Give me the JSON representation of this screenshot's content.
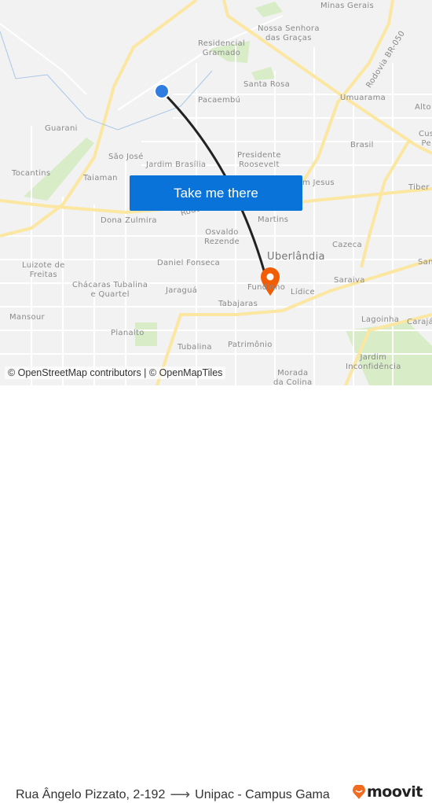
{
  "map": {
    "labels": [
      "Minas Gerais",
      "Nossa Senhora\ndas Graças",
      "Residencial\nGramado",
      "Santa Rosa",
      "Rodovia BR-050",
      "Umuarama",
      "Alto",
      "Pacaembú",
      "Guarani",
      "Brasil",
      "Cus\nPe",
      "São José",
      "Jardim Brasília",
      "Presidente\nRoosevelt",
      "Tocantins",
      "Taiaman",
      "m Jesus",
      "Tiber",
      "Rodo",
      "Dona Zulmira",
      "Martins",
      "Osvaldo\nRezende",
      "Luizote de\nFreitas",
      "Daniel Fonseca",
      "Cazeca",
      "San",
      "Chácaras Tubalina\ne Quartel",
      "Jaraguá",
      "Fundinho",
      "Lídice",
      "Saraiva",
      "Mansour",
      "Tabajaras",
      "Lagoinha",
      "Carajá",
      "Planalto",
      "Tubalina",
      "Patrimônio",
      "Jardim\nInconfidência",
      "Morada\nda Colina",
      "Uberlândia"
    ],
    "origin_color": "#2f7de1",
    "destination_color": "#f25c05",
    "route_color": "#222222"
  },
  "cta": {
    "label": "Take me there",
    "color": "#0a73d9"
  },
  "attribution": "© OpenStreetMap contributors | © OpenMapTiles",
  "footer": {
    "origin": "Rua Ângelo Pizzato, 2-192",
    "arrow_icon": "arrow-right-icon",
    "destination": "Unipac - Campus Gama",
    "brand": "moovit",
    "brand_color": "#f26b21"
  }
}
